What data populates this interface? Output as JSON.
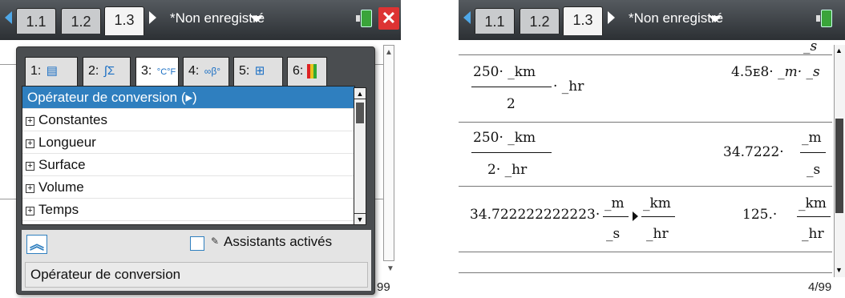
{
  "left": {
    "tabs": [
      "1.1",
      "1.2",
      "1.3"
    ],
    "doc_name": "*Non enregistré",
    "catalog_tabs": [
      {
        "num": "1:",
        "icon": "catalog-book-icon"
      },
      {
        "num": "2:",
        "icon": "∫Σ"
      },
      {
        "num": "3:",
        "icon": "°C°F"
      },
      {
        "num": "4:",
        "icon": "∞β°"
      },
      {
        "num": "5:",
        "icon": "templates-icon"
      },
      {
        "num": "6:",
        "icon": "libraries-icon"
      }
    ],
    "list": [
      "Opérateur de conversion (▸)",
      "Constantes",
      "Longueur",
      "Surface",
      "Volume",
      "Temps"
    ],
    "wizard_label": "Assistants activés",
    "description": "Opérateur de conversion",
    "page_indicator": "99"
  },
  "right": {
    "tabs": [
      "1.1",
      "1.2",
      "1.3"
    ],
    "doc_name": "*Non enregistré",
    "top_partial": "_s",
    "rows": [
      {
        "num": "250· _km",
        "den": "2",
        "tail": "· _hr",
        "res_prefix": "4.5ᴇ8· ",
        "res_unit": "_m· _s"
      },
      {
        "num": "250· _km",
        "den": "2· _hr",
        "res_prefix": "34.7222·",
        "res_num": "_m",
        "res_den": "_s"
      },
      {
        "prefix": "34.722222222223·",
        "f1_num": "_m",
        "f1_den": "_s",
        "f2_num": "_km",
        "f2_den": "_hr",
        "res_prefix": "125.·",
        "res_num": "_km",
        "res_den": "_hr"
      }
    ],
    "page_indicator": "4/99"
  }
}
